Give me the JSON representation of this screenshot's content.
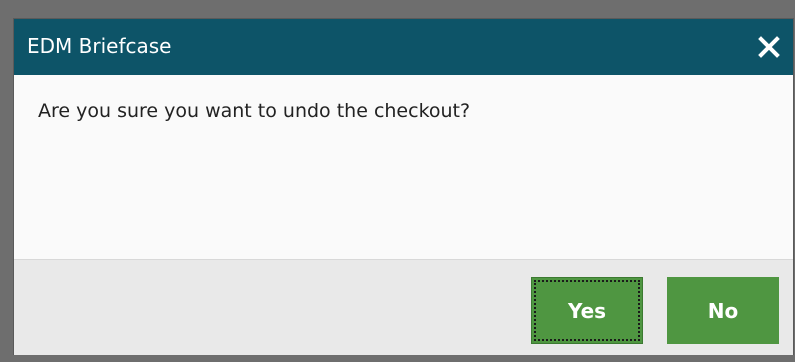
{
  "dialog": {
    "title": "EDM Briefcase",
    "close_icon": "close-icon",
    "message": "Are you sure you want to undo the checkout?",
    "buttons": {
      "yes_label": "Yes",
      "no_label": "No"
    },
    "colors": {
      "titlebar": "#0d5468",
      "button": "#4f9641",
      "footer": "#e9e9e9"
    }
  }
}
